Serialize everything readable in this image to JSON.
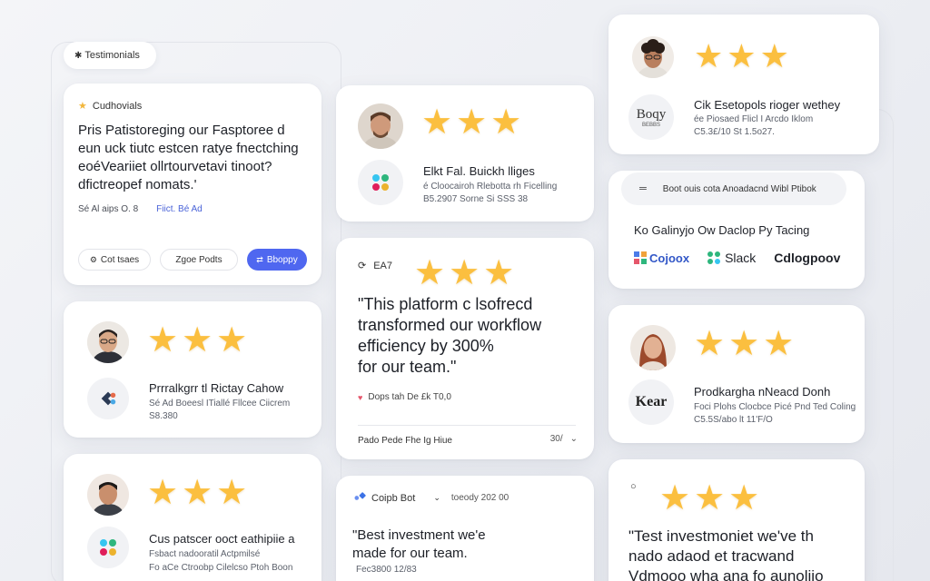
{
  "badge": {
    "label": "Testimonials"
  },
  "intro": {
    "eyebrow": "Cudhovials",
    "heading_lines": [
      "Pris Patistoreging our Fasptoree d",
      "eun uck tiutc estcen ratye fnectching",
      "eoéVeariiet ollrtourvetavi tinoot?",
      "dfictreopef nomats.'"
    ],
    "meta_left": "Sé Al aips O. 8",
    "meta_link": "Fiict. Bé Ad",
    "chip_1": "Cot tsaes",
    "chip_2": "Zgoe Podts",
    "cta": "Bboppy"
  },
  "col1_card2": {
    "name": "Prrralkgrr tl Rictay Cahow",
    "sub_1": "Sé Ad Boeesl ITiallé Fllcee Ciicrem",
    "sub_2": "S8.380"
  },
  "col1_card3": {
    "name": "Cus patscer ooct eathipiie a",
    "sub_1": "Fsbact nadooratil Actpmilsé",
    "sub_2": "Fo aCe Ctroobp Cilelcso Ptoh Boon"
  },
  "col2_card1": {
    "name": "Elkt Fal. Buickh lliges",
    "sub_1": "é Cloocairoh Rlebotta rh Ficelling",
    "sub_2": "B5.2907 Sorne Si SSS 38"
  },
  "col2_card2": {
    "label": "EA7",
    "quote_lines": [
      "\"This platform c lsofrecd",
      "transformed our workflow",
      "efficiency by 300%",
      "for our team.\""
    ],
    "meta": "Dops tah De £k T0,0",
    "footer_left": "Pado Pede Fhe Ig Hiue",
    "footer_right": "30/"
  },
  "col2_card3": {
    "brand": "Coipb Bot",
    "date": "toeody 202 00",
    "quote_lines": [
      "\"Best investment we'e",
      "made for our team."
    ],
    "meta": "Fec3800 12/83"
  },
  "col3_card1": {
    "name": "Cik Esetopols rioger wethey",
    "logo_text": "Boqy",
    "logo_sub": "BEBBS",
    "sub_1": "ée Piosaed Flicl I Arcdo Iklom",
    "sub_2": "C5.3£/10 St 1.5o27."
  },
  "col3_card2": {
    "search_text": "Boot ouis cota Anoadacnd Wibl Ptibok",
    "heading": "Ko Galinyjo Ow Daclop Py Tacing",
    "logos": [
      "Cojoox",
      "Slack",
      "Cdlogpoov"
    ]
  },
  "col3_card3": {
    "name": "Prodkargha nNeacd Donh",
    "logo_text": "Kear",
    "sub_1": "Foci Plohs Clocbce Picé Pnd Ted Coling",
    "sub_2": "C5.5S/abo lt 11'F/O"
  },
  "col3_card4": {
    "quote_lines": [
      "\"Test investmoniet we've th",
      "nado adaod et tracwand",
      "Vdmooo wha ana fo aunoliio"
    ]
  },
  "colors": {
    "star": "#fbbf3f",
    "accent_blue": "#4f67f0",
    "link_blue": "#4a63d8",
    "text": "#1f2229"
  },
  "icons": [
    "sparkle-icon",
    "star-icon",
    "heart-icon",
    "chevron-down-icon",
    "search-icon",
    "slack-logo-icon",
    "bot-icon"
  ],
  "ratings": {
    "stars_per_card": 3
  }
}
